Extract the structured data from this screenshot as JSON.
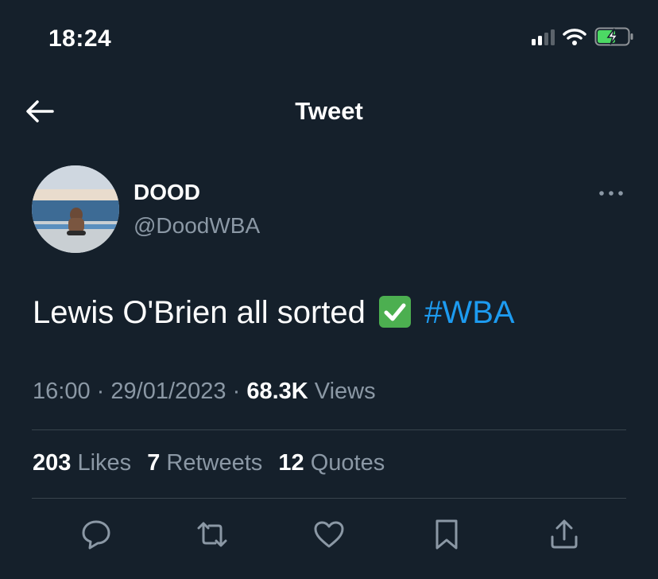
{
  "status_bar": {
    "time": "18:24",
    "icons": [
      "cellular-signal-icon",
      "wifi-icon",
      "battery-charging-icon"
    ]
  },
  "header": {
    "title": "Tweet",
    "back_icon": "arrow-left-icon"
  },
  "tweet": {
    "author": {
      "name": "DOOD",
      "handle": "@DoodWBA",
      "avatar": "profile photo: man sitting by infinity pool facing the sea"
    },
    "text": "Lewis O'Brien all sorted",
    "emoji": "white-heavy-check-mark",
    "hashtag": "#WBA",
    "time": "16:00",
    "separator": "·",
    "date": "29/01/2023",
    "views_count": "68.3K",
    "views_label": "Views"
  },
  "stats": {
    "likes_count": "203",
    "likes_label": "Likes",
    "retweets_count": "7",
    "retweets_label": "Retweets",
    "quotes_count": "12",
    "quotes_label": "Quotes"
  },
  "actions": [
    "reply-icon",
    "retweet-icon",
    "like-icon",
    "bookmark-icon",
    "share-icon"
  ],
  "colors": {
    "background": "#15202b",
    "text": "#ffffff",
    "secondary_text": "#8b98a5",
    "accent": "#1d9bf0",
    "divider": "#38444d",
    "battery_fill": "#4cd964"
  }
}
